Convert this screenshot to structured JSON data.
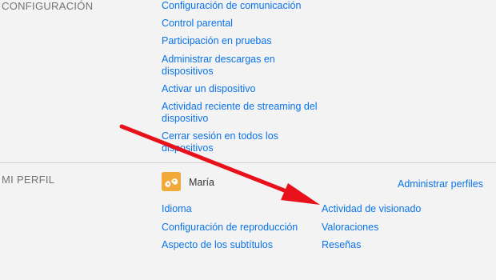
{
  "settings_section": {
    "title": "CONFIGURACIÓN",
    "links": [
      "Configuración de comunicación",
      "Control parental",
      "Participación en pruebas",
      "Administrar descargas en",
      "dispositivos",
      "Activar un dispositivo",
      "Actividad reciente de streaming del",
      "dispositivo",
      "Cerrar sesión en todos los",
      "dispositivos"
    ]
  },
  "profile_section": {
    "title": "MI PERFIL",
    "profile_name": "María",
    "manage_profiles": "Administrar perfiles",
    "left_links": [
      "Idioma",
      "Configuración de reproducción",
      "Aspecto de los subtítulos"
    ],
    "right_links": [
      "Actividad de visionado",
      "Valoraciones",
      "Reseñas"
    ]
  },
  "colors": {
    "link": "#0a73eb",
    "arrow": "#e8111b",
    "background": "#f3f3f3",
    "avatar": "#f2a93b"
  },
  "icons": {
    "avatar": "profile-avatar-icon",
    "annotation": "red-arrow-annotation"
  }
}
